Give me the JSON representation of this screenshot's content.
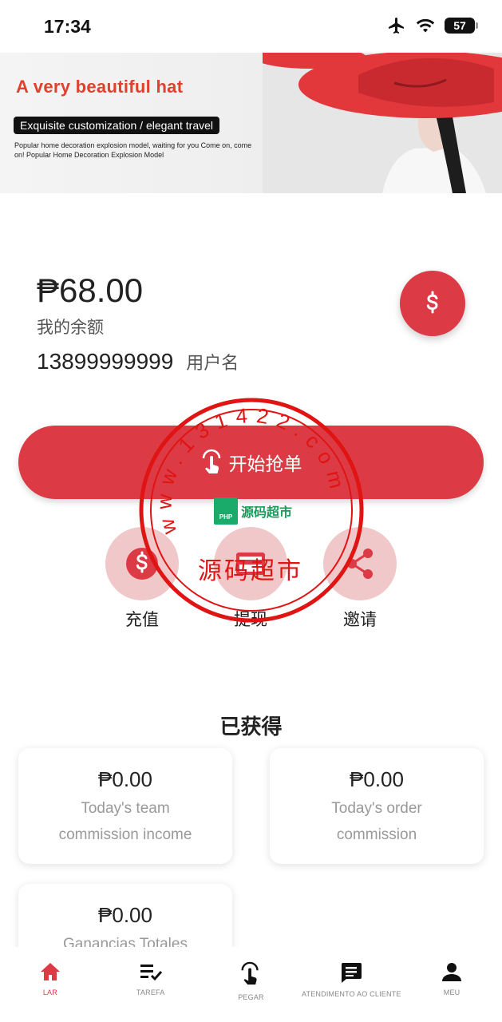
{
  "status_bar": {
    "time": "17:34",
    "battery": "57"
  },
  "banner": {
    "title": "A very beautiful hat",
    "tagline": "Exquisite customization / elegant travel",
    "description": "Popular home decoration explosion model, waiting for you Come on, come on! Popular Home Decoration Explosion Model"
  },
  "account": {
    "balance": "₱68.00",
    "balance_label": "我的余额",
    "phone": "13899999999",
    "username_label": "用户名"
  },
  "grab_button": {
    "label": "开始抢单"
  },
  "quick_actions": [
    {
      "label": "充值",
      "icon": "dollar-icon"
    },
    {
      "label": "提现",
      "icon": "card-icon"
    },
    {
      "label": "邀请",
      "icon": "share-icon"
    }
  ],
  "earned": {
    "title": "已获得",
    "cards": [
      {
        "amount": "₱0.00",
        "label": "Today's team commission income"
      },
      {
        "amount": "₱0.00",
        "label": "Today's order commission"
      },
      {
        "amount": "₱0.00",
        "label": "Ganancias Totales"
      }
    ]
  },
  "tab_bar": {
    "tabs": [
      {
        "label": "LAR",
        "icon": "home-icon",
        "active": true
      },
      {
        "label": "TAREFA",
        "icon": "task-list-icon",
        "active": false
      },
      {
        "label": "PEGAR",
        "icon": "tap-hand-icon",
        "active": false
      },
      {
        "label": "ATENDIMENTO AO CLIENTE",
        "icon": "chat-icon",
        "active": false
      },
      {
        "label": "MEU",
        "icon": "person-icon",
        "active": false
      }
    ]
  },
  "watermark": {
    "ring_text": "www.131422.com",
    "center_text": "源码超市",
    "logo_text": "源码超市",
    "logo_badge": "PHP"
  },
  "colors": {
    "accent": "#dc3b45",
    "accent_light": "#f0c8ca",
    "banner_title": "#e0402d"
  }
}
